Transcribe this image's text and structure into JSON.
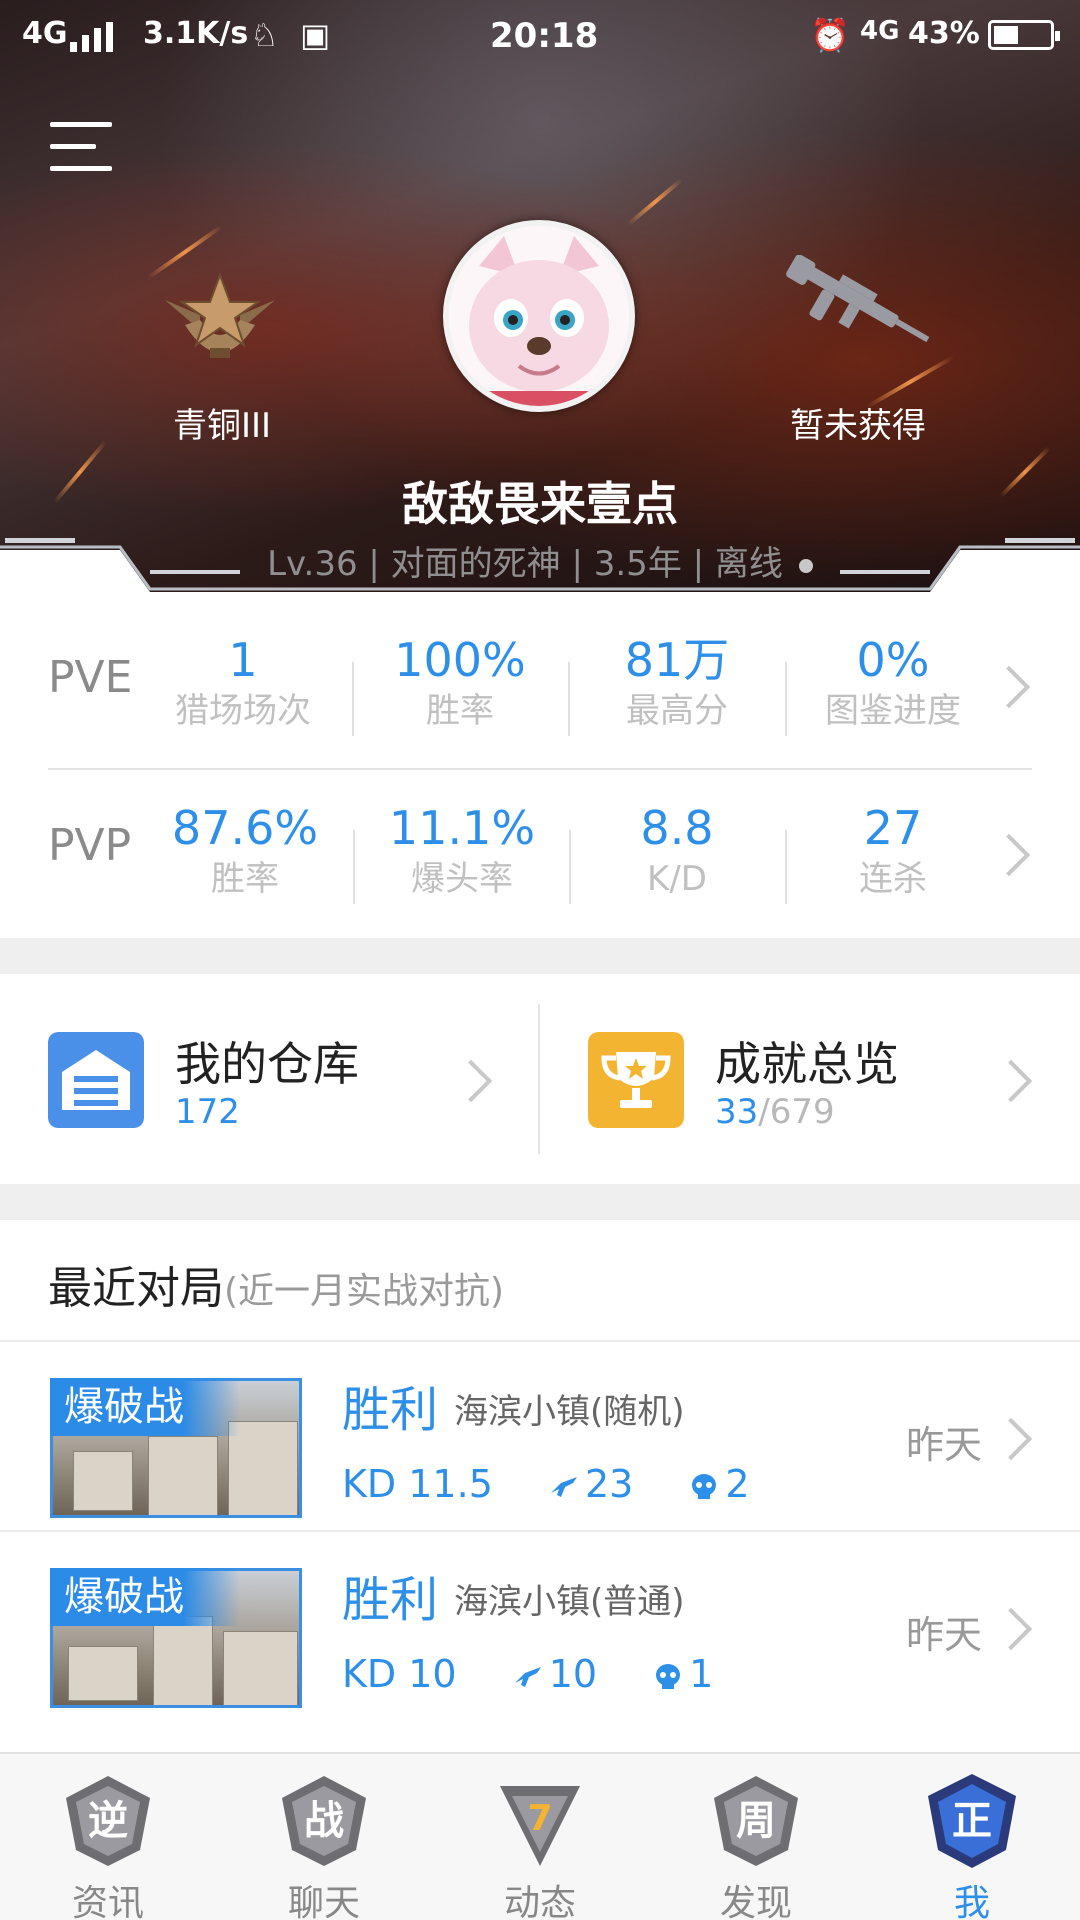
{
  "status_bar": {
    "network": "4G",
    "speed": "3.1K/s",
    "time": "20:18",
    "network2": "4G",
    "battery": "43%"
  },
  "profile": {
    "rank_label": "青铜III",
    "weapon_label": "暂未获得",
    "name": "敌敌畏来壹点",
    "meta": "Lv.36 | 对面的死神 | 3.5年 |  离线"
  },
  "pve": {
    "label": "PVE",
    "stats": [
      {
        "value": "1",
        "name": "猎场场次"
      },
      {
        "value": "100%",
        "name": "胜率"
      },
      {
        "value": "81万",
        "name": "最高分"
      },
      {
        "value": "0%",
        "name": "图鉴进度"
      }
    ]
  },
  "pvp": {
    "label": "PVP",
    "stats": [
      {
        "value": "87.6%",
        "name": "胜率"
      },
      {
        "value": "11.1%",
        "name": "爆头率"
      },
      {
        "value": "8.8",
        "name": "K/D"
      },
      {
        "value": "27",
        "name": "连杀"
      }
    ]
  },
  "cards": {
    "warehouse": {
      "title": "我的仓库",
      "count": "172",
      "color": "#4a8fe8"
    },
    "achievement": {
      "title": "成就总览",
      "count": "33",
      "total": "/679",
      "color": "#f2b431"
    }
  },
  "recent": {
    "title": "最近对局",
    "subtitle": "(近一月实战对抗)",
    "matches": [
      {
        "mode": "爆破战",
        "result": "胜利",
        "map": "海滨小镇(随机)",
        "kd": "KD 11.5",
        "kills": "23",
        "headshots": "2",
        "time": "昨天"
      },
      {
        "mode": "爆破战",
        "result": "胜利",
        "map": "海滨小镇(普通)",
        "kd": "KD 10",
        "kills": "10",
        "headshots": "1",
        "time": "昨天"
      }
    ]
  },
  "nav": {
    "items": [
      {
        "label": "资讯",
        "glyph": "逆"
      },
      {
        "label": "聊天",
        "glyph": "战"
      },
      {
        "label": "动态",
        "glyph": "7"
      },
      {
        "label": "发现",
        "glyph": "周"
      },
      {
        "label": "我",
        "glyph": "正"
      }
    ],
    "active": "我",
    "active_color": "#2e8fe8"
  }
}
